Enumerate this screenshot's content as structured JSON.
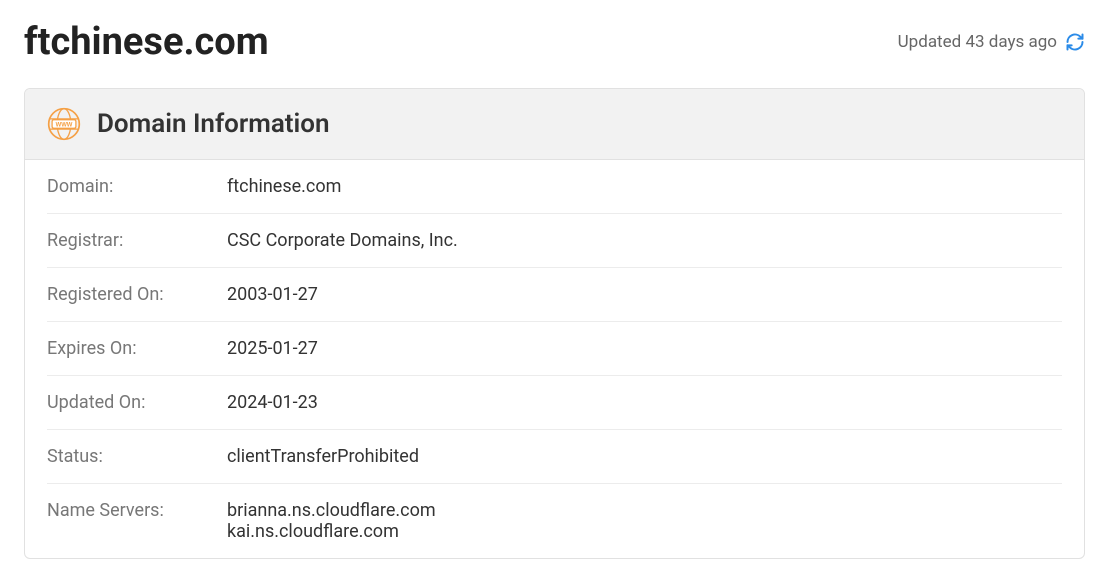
{
  "header": {
    "title": "ftchinese.com",
    "updated_text": "Updated 43 days ago"
  },
  "card": {
    "title": "Domain Information",
    "rows": [
      {
        "label": "Domain:",
        "value": "ftchinese.com"
      },
      {
        "label": "Registrar:",
        "value": "CSC Corporate Domains, Inc."
      },
      {
        "label": "Registered On:",
        "value": "2003-01-27"
      },
      {
        "label": "Expires On:",
        "value": "2025-01-27"
      },
      {
        "label": "Updated On:",
        "value": "2024-01-23"
      },
      {
        "label": "Status:",
        "value": "clientTransferProhibited"
      },
      {
        "label": "Name Servers:",
        "value": "brianna.ns.cloudflare.com\nkai.ns.cloudflare.com"
      }
    ]
  }
}
